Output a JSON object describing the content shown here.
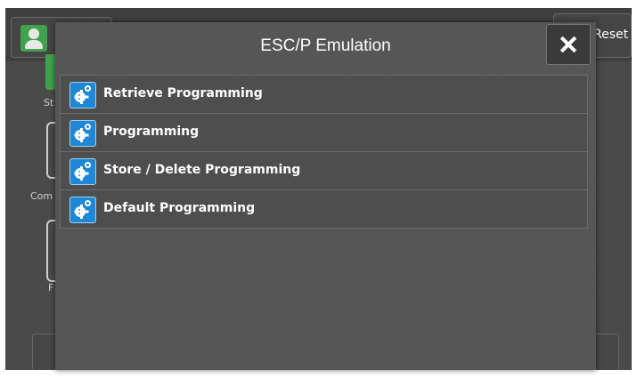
{
  "header": {
    "reset_label": "Reset"
  },
  "background": {
    "fragments": [
      "St",
      "Com",
      "F"
    ]
  },
  "dialog": {
    "title": "ESC/P Emulation",
    "items": [
      {
        "label": "Retrieve Programming",
        "icon": "gear-icon"
      },
      {
        "label": "Programming",
        "icon": "gear-icon"
      },
      {
        "label": "Store / Delete Programming",
        "icon": "gear-icon"
      },
      {
        "label": "Default Programming",
        "icon": "gear-icon"
      }
    ]
  },
  "colors": {
    "accent_green": "#3fa34d",
    "item_icon_blue": "#1e88d6",
    "dialog_bg": "#545454"
  }
}
